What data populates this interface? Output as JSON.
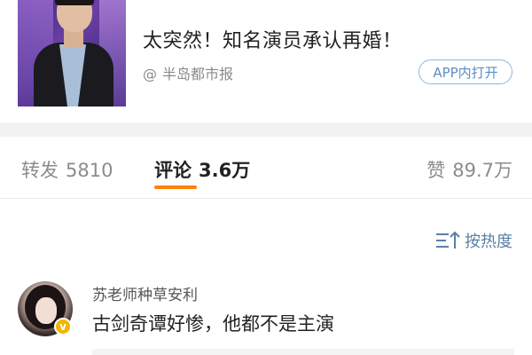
{
  "article": {
    "title": "太突然！知名演员承认再婚！",
    "source_prefix": "@",
    "source": "半岛都市报",
    "app_button": "APP内打开"
  },
  "stats": {
    "repost_label": "转发",
    "repost_count": "5810",
    "comment_label": "评论",
    "comment_count": "3.6万",
    "like_label": "赞",
    "like_count": "89.7万",
    "active_tab": "comment",
    "accent": "#ff8200"
  },
  "sort": {
    "icon": "sort-icon",
    "label": "按热度"
  },
  "comments": [
    {
      "user": "苏老师种草安利",
      "verified": true,
      "text": "古剑奇谭好惨，他都不是主演"
    }
  ]
}
